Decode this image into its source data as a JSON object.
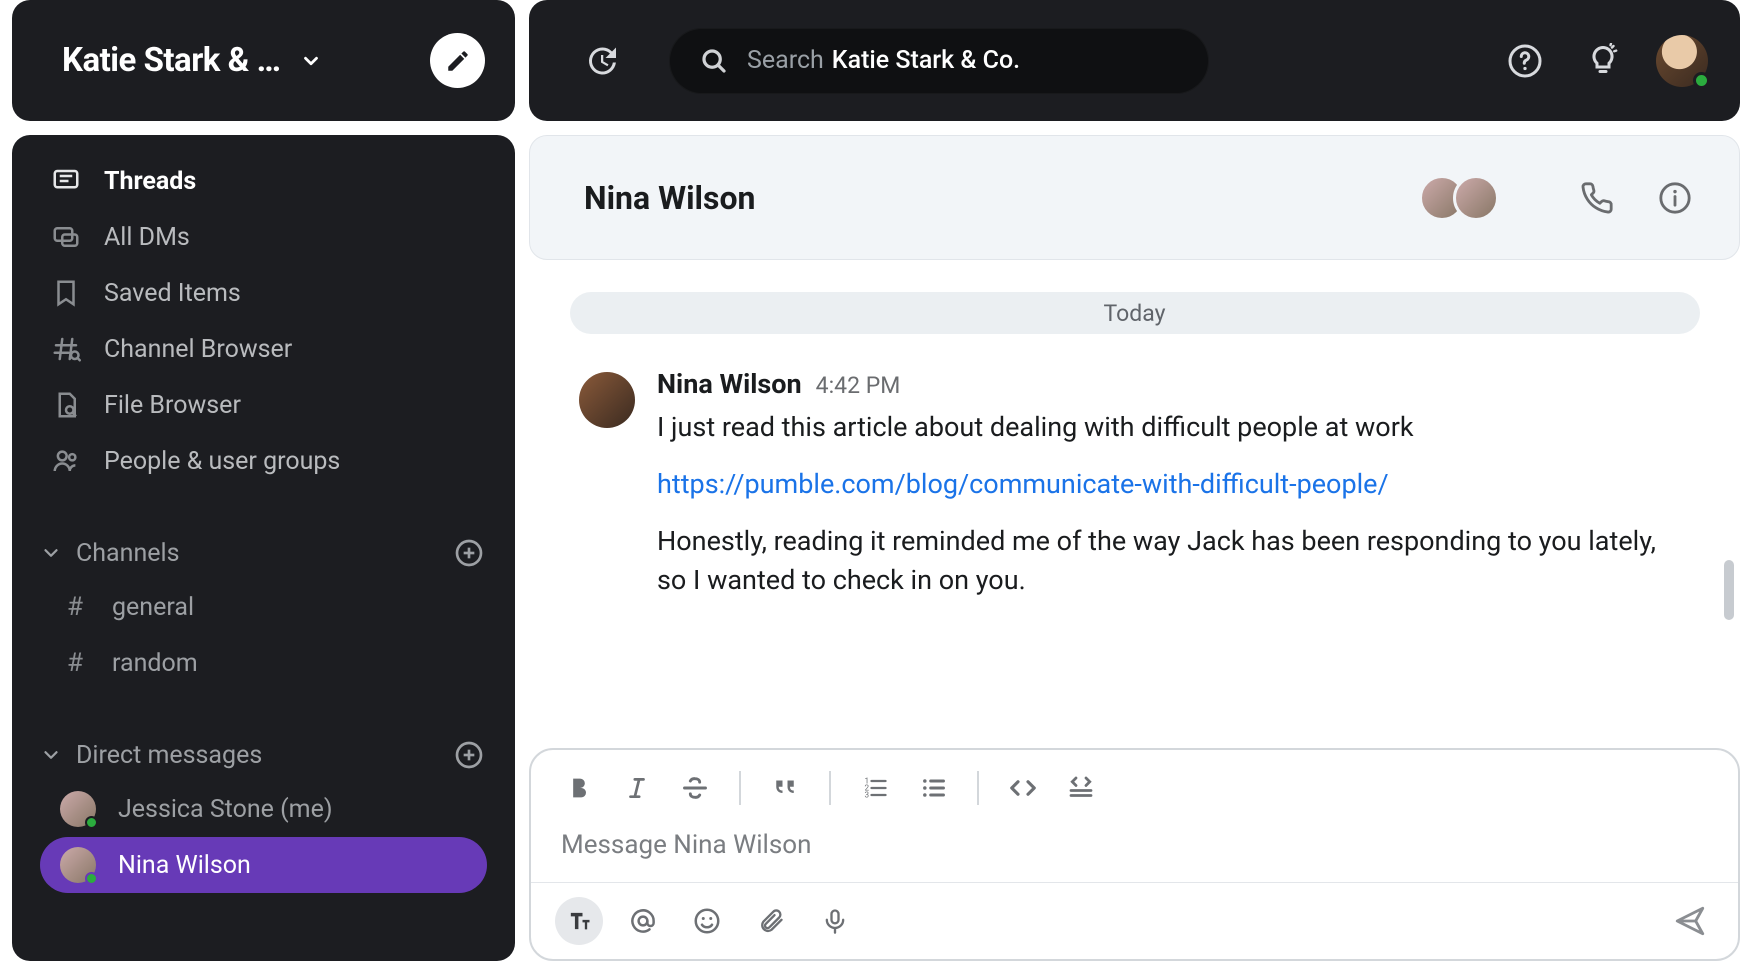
{
  "workspace": {
    "title": "Katie Stark & …"
  },
  "search": {
    "label": "Search",
    "scope": "Katie Stark & Co."
  },
  "sidebar": {
    "nav": [
      {
        "label": "Threads"
      },
      {
        "label": "All DMs"
      },
      {
        "label": "Saved Items"
      },
      {
        "label": "Channel Browser"
      },
      {
        "label": "File Browser"
      },
      {
        "label": "People & user groups"
      }
    ],
    "channels_header": "Channels",
    "channels": [
      {
        "name": "general"
      },
      {
        "name": "random"
      }
    ],
    "dms_header": "Direct messages",
    "dms": [
      {
        "name": "Jessica Stone (me)"
      },
      {
        "name": "Nina Wilson"
      }
    ]
  },
  "conversation": {
    "title": "Nina Wilson",
    "divider": "Today",
    "messages": [
      {
        "author": "Nina Wilson",
        "time": "4:42 PM",
        "text1": "I just read this article about dealing with difficult people at work",
        "link": "https://pumble.com/blog/communicate-with-difficult-people/",
        "text2": "Honestly, reading it reminded me of the way Jack has been responding to you lately, so I wanted to check in on you."
      }
    ]
  },
  "composer": {
    "placeholder": "Message Nina Wilson"
  }
}
